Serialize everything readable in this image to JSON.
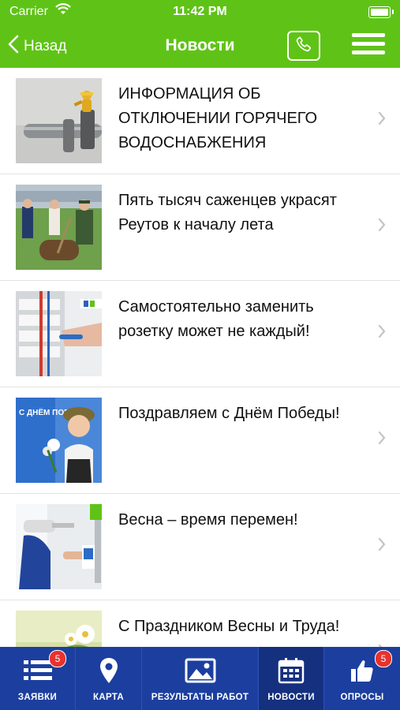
{
  "status": {
    "carrier": "Carrier",
    "time": "11:42 PM"
  },
  "nav": {
    "back": "Назад",
    "title": "Новости"
  },
  "news": [
    {
      "title": "ИНФОРМАЦИЯ ОБ ОТКЛЮЧЕНИИ ГОРЯЧЕГО ВОДОСНАБЖЕНИЯ"
    },
    {
      "title": "Пять тысяч саженцев украсят Реутов к началу лета"
    },
    {
      "title": "Самостоятельно заменить розетку может не каждый!"
    },
    {
      "title": "Поздравляем с Днём Победы!",
      "thumb_text": "С ДНЁМ ПОБЕДЫ!"
    },
    {
      "title": "Весна – время перемен!"
    },
    {
      "title": "С Праздником Весны и Труда!"
    }
  ],
  "tabs": [
    {
      "label": "ЗАЯВКИ",
      "badge": "5"
    },
    {
      "label": "КАРТА"
    },
    {
      "label": "РЕЗУЛЬТАТЫ РАБОТ"
    },
    {
      "label": "НОВОСТИ"
    },
    {
      "label": "ОПРОСЫ",
      "badge": "5"
    }
  ],
  "colors": {
    "header_green": "#5fc317",
    "tabbar_blue": "#1c3f9f",
    "tab_active": "#14307e",
    "badge_red": "#e8322e"
  }
}
